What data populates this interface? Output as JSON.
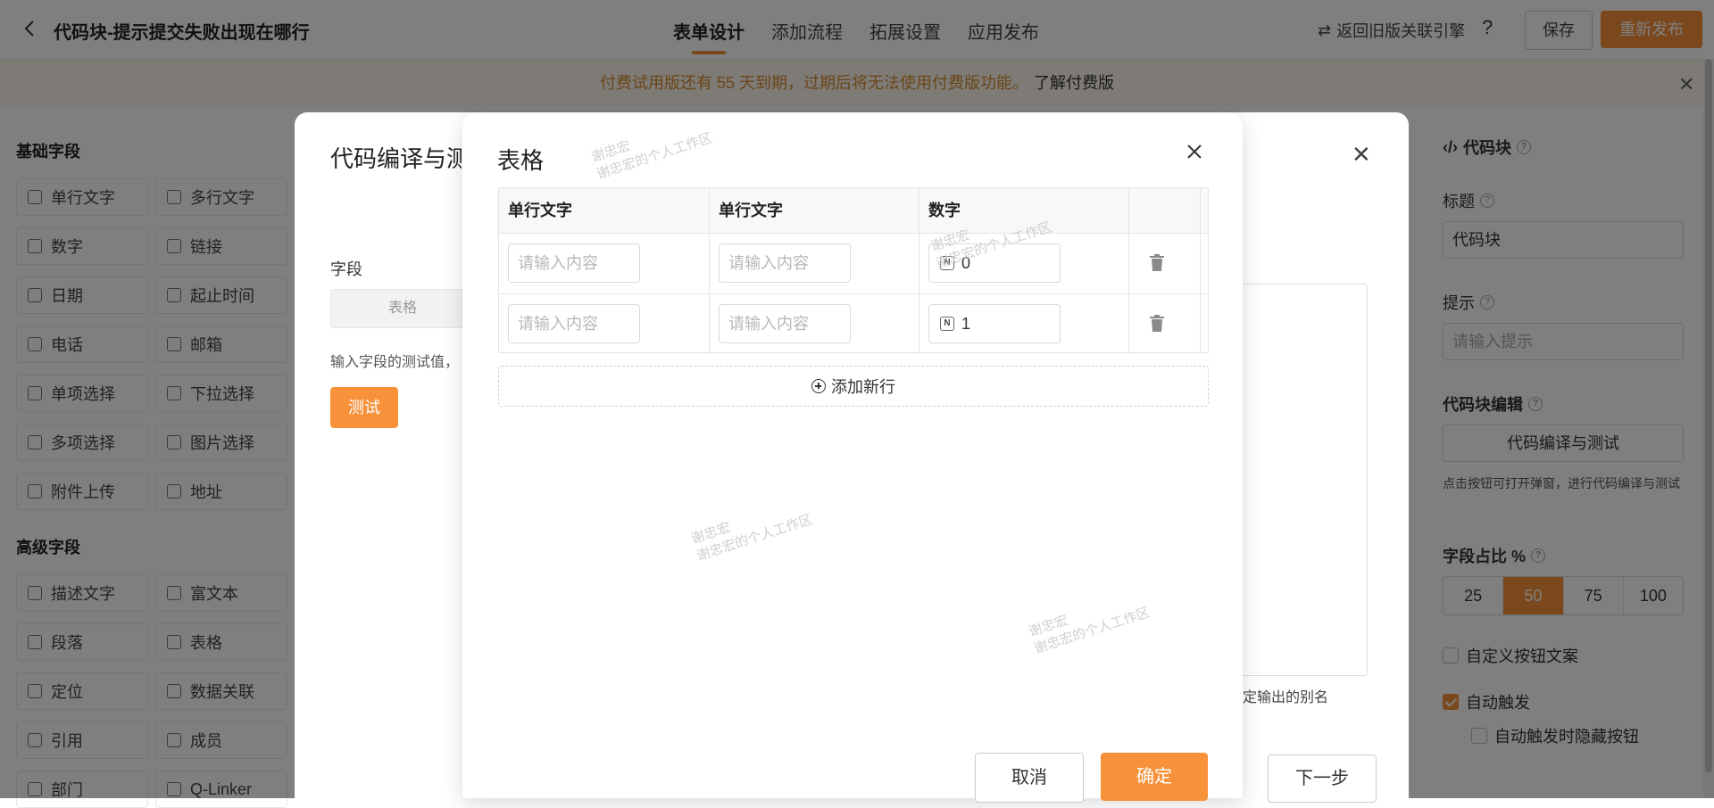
{
  "header": {
    "title": "代码块-提示提交失败出现在哪行",
    "tabs": [
      "表单设计",
      "添加流程",
      "拓展设置",
      "应用发布"
    ],
    "engine_link": "返回旧版关联引擎",
    "save_label": "保存",
    "publish_label": "重新发布"
  },
  "banner": {
    "text": "付费试用版还有 55 天到期，过期后将无法使用付费版功能。",
    "link": "了解付费版"
  },
  "left_panel": {
    "basic_title": "基础字段",
    "basic_fields": [
      "单行文字",
      "多行文字",
      "数字",
      "链接",
      "日期",
      "起止时间",
      "电话",
      "邮箱",
      "单项选择",
      "下拉选择",
      "多项选择",
      "图片选择",
      "附件上传",
      "地址"
    ],
    "advanced_title": "高级字段",
    "advanced_fields": [
      "描述文字",
      "富文本",
      "段落",
      "表格",
      "定位",
      "数据关联",
      "引用",
      "成员",
      "部门",
      "Q-Linker"
    ]
  },
  "right_panel": {
    "header": "代码块",
    "title_label": "标题",
    "title_value": "代码块",
    "hint_label": "提示",
    "hint_placeholder": "请输入提示",
    "code_edit_label": "代码块编辑",
    "code_edit_button": "代码编译与测试",
    "code_edit_note": "点击按钮可打开弹窗，进行代码编译与测试",
    "ratio_label": "字段占比 %",
    "ratio_options": [
      "25",
      "50",
      "75",
      "100"
    ],
    "ratio_selected": "50",
    "custom_button_text": "自定义按钮文案",
    "auto_trigger": "自动触发",
    "auto_trigger_hide": "自动触发时隐藏按钮"
  },
  "bg_modal": {
    "title": "代码编译与测",
    "field_label": "字段",
    "field_value": "表格",
    "hint": "输入字段的测试值，",
    "test_button": "测试",
    "alias_text": "行为绑定输出的别名",
    "next_button": "下一步"
  },
  "dialog": {
    "title": "表格",
    "columns": [
      "单行文字",
      "单行文字",
      "数字"
    ],
    "rows": [
      {
        "text1": "请输入内容",
        "text2": "请输入内容",
        "number": "0"
      },
      {
        "text1": "请输入内容",
        "text2": "请输入内容",
        "number": "1"
      }
    ],
    "add_row": "添加新行",
    "cancel": "取消",
    "confirm": "确定"
  },
  "watermark": {
    "name": "谢忠宏",
    "workspace": "谢忠宏的个人工作区"
  },
  "colors": {
    "accent": "#f7913a",
    "overlay": "rgba(0,0,0,0.5)"
  }
}
